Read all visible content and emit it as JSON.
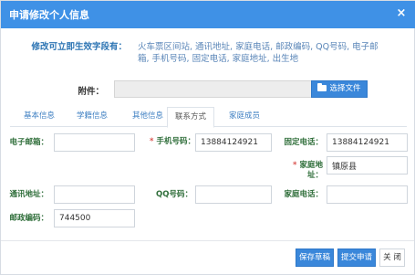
{
  "dialog": {
    "title": "申请修改个人信息",
    "close_label": "×"
  },
  "notice": {
    "label": "修改可立即生效字段有：",
    "text": "火车票区间站, 通讯地址, 家庭电话, 邮政编码, QQ号码, 电子邮箱, 手机号码, 固定电话, 家庭地址, 出生地"
  },
  "attachment": {
    "label": "附件：",
    "value": "",
    "choose_label": "选择文件"
  },
  "tabs": [
    {
      "label": "基本信息"
    },
    {
      "label": "学籍信息"
    },
    {
      "label": "其他信息"
    },
    {
      "label": "联系方式"
    },
    {
      "label": "家庭成员"
    }
  ],
  "active_tab": "联系方式",
  "form": {
    "email": {
      "label": "电子邮箱：",
      "value": ""
    },
    "mobile": {
      "label": "手机号码：",
      "value": "13884124921",
      "required": true
    },
    "landline": {
      "label": "固定电话：",
      "value": "13884124921"
    },
    "home_address": {
      "label": "家庭地址：",
      "value": "镇原县",
      "required": true
    },
    "address": {
      "label": "通讯地址：",
      "value": ""
    },
    "qq": {
      "label": "QQ号码：",
      "value": ""
    },
    "home_phone": {
      "label": "家庭电话：",
      "value": ""
    },
    "postcode": {
      "label": "邮政编码：",
      "value": "744500"
    }
  },
  "footer": {
    "save_draft": "保存草稿",
    "submit": "提交申请",
    "close": "关 闭"
  },
  "colors": {
    "title_bar": "#3f91e6",
    "accent": "#3a87da",
    "label_green": "#2f6e3a",
    "required": "#d9534f"
  }
}
